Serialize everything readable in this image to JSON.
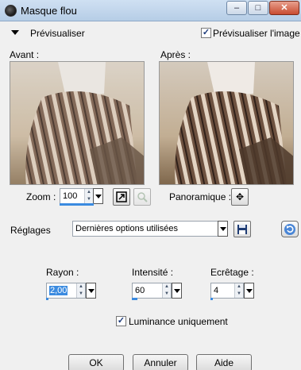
{
  "window": {
    "title": "Masque flou",
    "minimize_glyph": "–",
    "maximize_glyph": "□",
    "close_glyph": "✕"
  },
  "preview": {
    "label": "Prévisualiser",
    "checkbox_label": "Prévisualiser l'image",
    "checked": true
  },
  "panels": {
    "before_label": "Avant :",
    "after_label": "Après :"
  },
  "zoom": {
    "label": "Zoom :",
    "value": "100",
    "level_percent": 100
  },
  "pan": {
    "label": "Panoramique :"
  },
  "settings": {
    "label": "Réglages",
    "selected": "Dernières options utilisées"
  },
  "params": {
    "radius": {
      "label": "Rayon :",
      "value": "2,00"
    },
    "intensity": {
      "label": "Intensité :",
      "value": "60"
    },
    "clip": {
      "label": "Ecrêtage :",
      "value": "4"
    }
  },
  "luminance": {
    "label": "Luminance uniquement",
    "checked": true
  },
  "buttons": {
    "ok": "OK",
    "cancel": "Annuler",
    "help": "Aide"
  },
  "colors": {
    "accent": "#3b8be0",
    "title_bar": "#c2d6ec",
    "close": "#c84c30"
  }
}
